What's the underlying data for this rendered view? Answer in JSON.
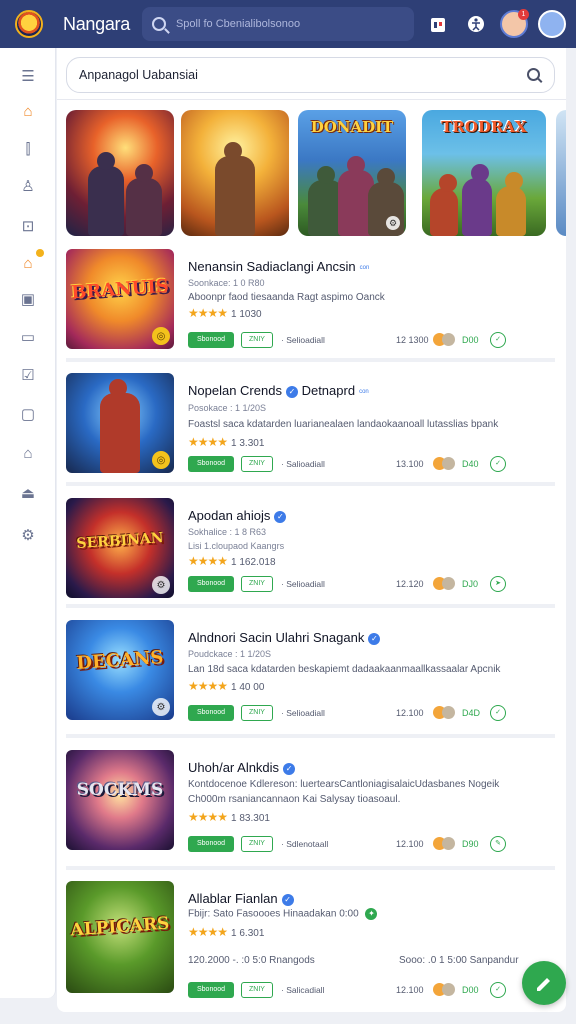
{
  "header": {
    "app_title": "Nangara",
    "search_placeholder": "Spoll fo Cbenialibolsonoo"
  },
  "top_icons": [
    {
      "icon": "store-icon"
    },
    {
      "icon": "accessibility-icon"
    },
    {
      "icon": "notification-avatar",
      "badge": "1"
    },
    {
      "icon": "user-avatar"
    }
  ],
  "sidebar": {
    "items": [
      {
        "icon": "menu-icon",
        "glyph": "☰"
      },
      {
        "icon": "home-icon",
        "glyph": "⌂"
      },
      {
        "icon": "chart-icon",
        "glyph": "⫿"
      },
      {
        "icon": "person-icon",
        "glyph": "♙"
      },
      {
        "icon": "bag-icon",
        "glyph": "⊡"
      },
      {
        "icon": "store-icon",
        "glyph": "⌂"
      },
      {
        "icon": "image-icon",
        "glyph": "▣"
      },
      {
        "icon": "monitor-icon",
        "glyph": "▭"
      },
      {
        "icon": "checklist-icon",
        "glyph": "☑"
      },
      {
        "icon": "tablet-icon",
        "glyph": "▢"
      },
      {
        "icon": "house-icon",
        "glyph": "⌂"
      },
      {
        "icon": "hanger-icon",
        "glyph": "⏏"
      },
      {
        "icon": "settings-icon",
        "glyph": "⚙"
      }
    ]
  },
  "main_search": {
    "value": "Anpanagol Uabansiai"
  },
  "carousel": [
    {
      "title": ""
    },
    {
      "title": ""
    },
    {
      "title": "DONADIT"
    },
    {
      "title": "TRODRAX"
    },
    {
      "title": ""
    }
  ],
  "games": [
    {
      "thumb_text": "BRANUIS",
      "title": "Nenansin Sadiaclangi Ancsin",
      "verified": false,
      "tag": "con",
      "sub": "Soonkace: 1 0 R80",
      "desc": "Aboonpr faod tiesaanda Ragt aspimo Oanck",
      "rating": "1 1030",
      "btn1": "Sbonood",
      "btn2": "ZNIY",
      "dev": "· Selioadiall",
      "size": "12 1300",
      "price": "D00"
    },
    {
      "thumb_text": "",
      "title": "Nopelan Crends",
      "title_b": "Detnaprd",
      "verified": true,
      "tag": "con",
      "sub": "Posokace : 1 1/20S",
      "desc": "Foastsl saca kdatarden luarianealaen landaokaanoall lutasslias bpank",
      "rating": "1 3.301",
      "btn1": "Sbonood",
      "btn2": "ZNIY",
      "dev": "· Salioadiall",
      "size": "13.100",
      "price": "D40"
    },
    {
      "thumb_text": "SERBINAN",
      "title": "Apodan ahiojs",
      "verified": true,
      "tag": "",
      "sub": "Sokhalice : 1 8 R63",
      "desc": "Lisi 1.cloupaod Kaangrs",
      "rating": "1 162.018",
      "btn1": "Sbonood",
      "btn2": "ZNIY",
      "dev": "· Selioadiall",
      "size": "12.120",
      "price": "DJ0"
    },
    {
      "thumb_text": "DECANS",
      "title": "Alndnori Sacin Ulahri Snagank",
      "verified": true,
      "tag": "",
      "sub": "Poudckace : 1 1/20S",
      "desc": "Lan 18d saca kdatarden beskapiemt dadaakaanmaallkassaalar Apcnik",
      "rating": "1 40 00",
      "btn1": "Sbonood",
      "btn2": "ZNIY",
      "dev": "· Selioadiall",
      "size": "12.100",
      "price": "D4D"
    },
    {
      "thumb_text": "SOCKMS",
      "title": "Uhoh/ar Alnkdis",
      "verified": true,
      "tag": "",
      "sub": "",
      "desc": "Kontdocenoe Kdlereson: luertearsCantloniagisalaicUdasbanes Nogeik",
      "desc2": "Ch000m rsaniancannaon Kai Salysay tioasoaul.",
      "rating": "1 83.301",
      "btn1": "Sbonood",
      "btn2": "ZNIY",
      "dev": "· Sdlenotaall",
      "size": "12.100",
      "price": "D90"
    },
    {
      "thumb_text": "ALPICARS",
      "title": "Allablar Fianlan",
      "verified": true,
      "tag": "",
      "sub": "Fbijr: Sato Fasoooes Hinaadakan 0:00",
      "desc": "",
      "rating": "1 6.301",
      "extra": "120.2000 -. :0 5:0 Rnangods",
      "extra2": "Sooo: .0 1 5:00 Sanpandur",
      "btn1": "Sbonood",
      "btn2": "ZNIY",
      "dev": "· Salicadiall",
      "size": "12.100",
      "price": "D00"
    }
  ],
  "colors": {
    "topbar": "#2e3f76",
    "accent_green": "#2fa84f",
    "star": "#f3a51c",
    "verified": "#3d7be8"
  }
}
